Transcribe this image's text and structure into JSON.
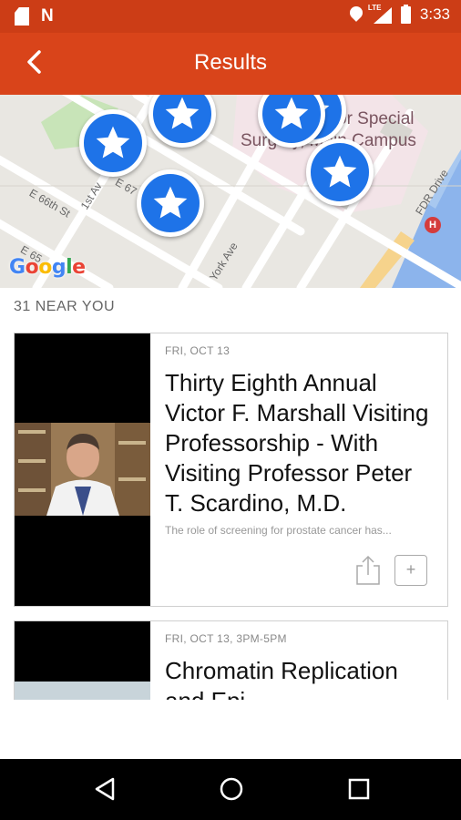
{
  "status_bar": {
    "time": "3:33",
    "network": "LTE",
    "icons": [
      "sd-card-icon",
      "n-icon",
      "location-pin-icon",
      "signal-icon",
      "battery-charging-icon"
    ]
  },
  "app_bar": {
    "title": "Results",
    "back_icon": "chevron-left-icon"
  },
  "map": {
    "labels": {
      "hospital_line1": "or Special",
      "hospital_line2": "Surgery, Main Campus",
      "street_66th": "E 66th St",
      "street_1st_av": "1st Av",
      "street_e67": "E 67",
      "street_york": "York Ave",
      "street_fdr": "FDR Drive",
      "street_e65": "E 65"
    },
    "logo": [
      "G",
      "o",
      "o",
      "g",
      "l",
      "e"
    ],
    "marker_icon": "star-icon",
    "marker_color": "#1e73e8"
  },
  "results": {
    "header": "31 NEAR YOU",
    "cards": [
      {
        "date": "FRI, OCT 13",
        "title": "Thirty Eighth Annual Victor F. Marshall Visiting Professorship - With Visiting Professor Peter T. Scardino, M.D.",
        "description": "The role of screening for prostate cancer has...",
        "share_icon": "share-icon",
        "add_label": "+"
      },
      {
        "date": "FRI, OCT 13, 3PM-5PM",
        "title": "Chromatin Replication and Epi...",
        "description": ""
      }
    ]
  },
  "nav_bar": {
    "back_icon": "triangle-back-icon",
    "home_icon": "circle-home-icon",
    "recents_icon": "square-recents-icon"
  },
  "colors": {
    "status_bar": "#cc3d16",
    "app_bar": "#d9441a",
    "marker": "#1e73e8"
  }
}
